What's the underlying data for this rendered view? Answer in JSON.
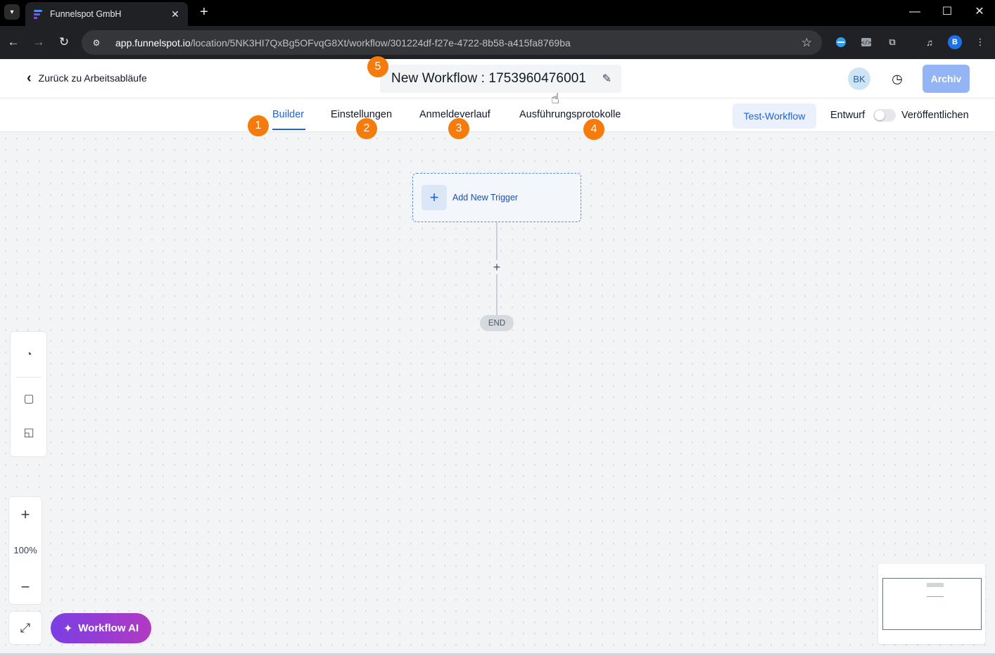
{
  "browser": {
    "tab_title": "Funnelspot GmbH",
    "url_host": "app.funnelspot.io",
    "url_path": "/location/5NK3HI7QxBg5OFvqG8Xt/workflow/301224df-f27e-4722-8b58-a415fa8769ba",
    "profile_initial": "B"
  },
  "header": {
    "back_label": "Zurück zu Arbeitsabläufe",
    "workflow_title": "New Workflow : 1753960476001",
    "avatar_initials": "BK",
    "archive_label": "Archiv"
  },
  "tabs": [
    {
      "label": "Builder",
      "active": true
    },
    {
      "label": "Einstellungen",
      "active": false
    },
    {
      "label": "Anmeldeverlauf",
      "active": false
    },
    {
      "label": "Ausführungsprotokolle",
      "active": false
    }
  ],
  "actions": {
    "test_workflow_label": "Test-Workflow",
    "draft_label": "Entwurf",
    "publish_label": "Veröffentlichen",
    "published": false
  },
  "canvas": {
    "trigger_label": "Add New Trigger",
    "end_label": "END",
    "zoom_level": "100%"
  },
  "ai_button_label": "Workflow AI",
  "annotations": {
    "badge_1": "1",
    "badge_2": "2",
    "badge_3": "3",
    "badge_4": "4",
    "badge_5": "5"
  },
  "colors": {
    "accent": "#1d63d9",
    "badge": "#f47b0c",
    "archive_button": "#93b4f5",
    "ai_gradient_start": "#7b3fe4",
    "ai_gradient_end": "#b13ac2"
  }
}
